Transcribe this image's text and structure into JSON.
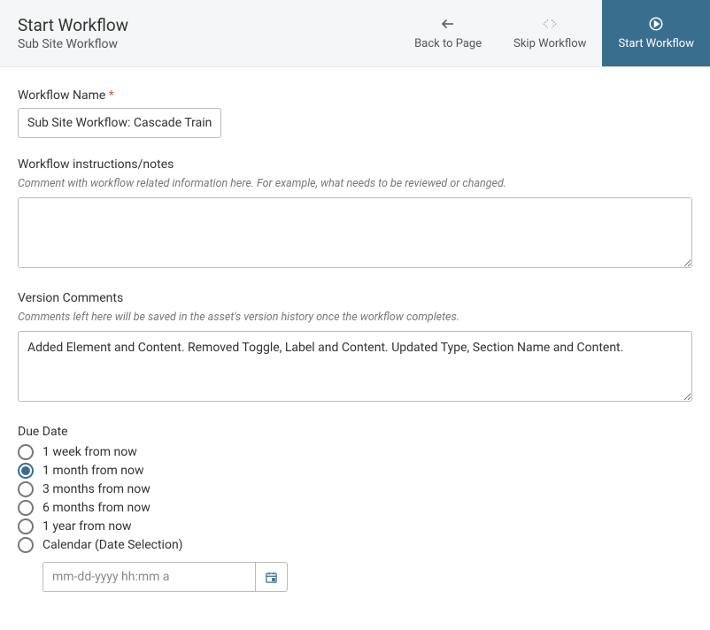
{
  "header": {
    "title": "Start Workflow",
    "subtitle": "Sub Site Workflow",
    "back_label": "Back to Page",
    "skip_label": "Skip Workflow",
    "start_label": "Start Workflow"
  },
  "form": {
    "workflow_name": {
      "label": "Workflow Name",
      "required": "*",
      "value": "Sub Site Workflow: Cascade Training"
    },
    "instructions": {
      "label": "Workflow instructions/notes",
      "help": "Comment with workflow related information here. For example, what needs to be reviewed or changed.",
      "value": ""
    },
    "version_comments": {
      "label": "Version Comments",
      "help": "Comments left here will be saved in the asset's version history once the workflow completes.",
      "value": "Added Element and Content. Removed Toggle, Label and Content. Updated Type, Section Name and Content."
    },
    "due_date": {
      "label": "Due Date",
      "selected_index": 1,
      "options": [
        "1 week from now",
        "1 month from now",
        "3 months from now",
        "6 months from now",
        "1 year from now",
        "Calendar (Date Selection)"
      ],
      "date_placeholder": "mm-dd-yyyy hh:mm a"
    }
  }
}
